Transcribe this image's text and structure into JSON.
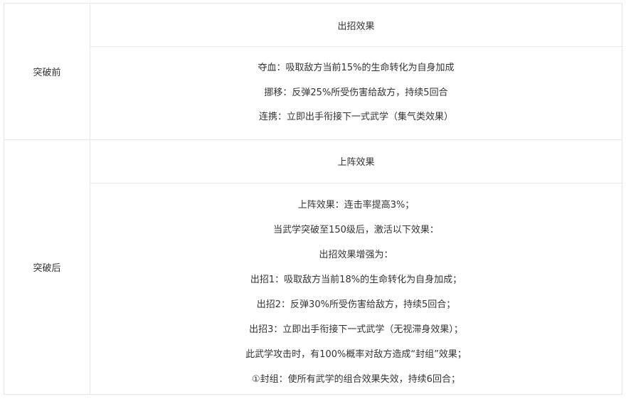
{
  "before": {
    "label": "突破前",
    "header": "出招效果",
    "lines": [
      "夺血：吸取敌方当前15%的生命转化为自身加成",
      "挪移：反弹25%所受伤害给敌方，持续5回合",
      "连携：立即出手衔接下一式武学（集气类效果）"
    ]
  },
  "after": {
    "label": "突破后",
    "header": "上阵效果",
    "lines": [
      "上阵效果：连击率提高3%；",
      "当武学突破至150级后，激活以下效果：",
      "出招效果增强为：",
      "出招1：吸取敌方当前18%的生命转化为自身加成；",
      "出招2：反弹30%所受伤害给敌方，持续5回合；",
      "出招3：立即出手衔接下一式武学（无视滞身效果）；",
      "此武学攻击时，有100%概率对敌方造成“封组”效果；",
      "①封组：使所有武学的组合效果失效，持续6回合；"
    ]
  }
}
